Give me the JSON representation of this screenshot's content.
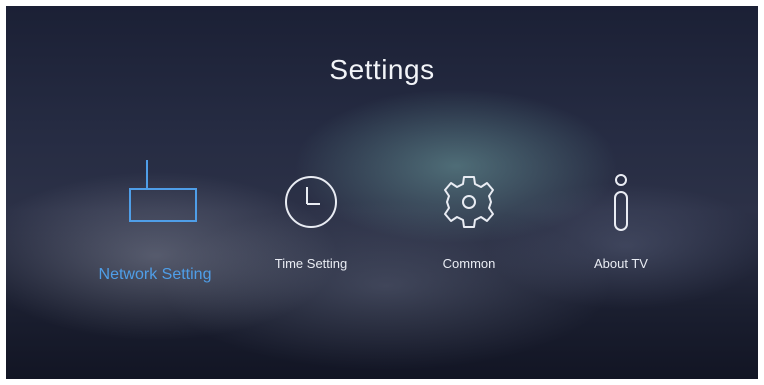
{
  "header": {
    "title": "Settings"
  },
  "menu": {
    "items": [
      {
        "label": "Network Setting",
        "icon": "router-icon",
        "selected": true
      },
      {
        "label": "Time Setting",
        "icon": "clock-icon",
        "selected": false
      },
      {
        "label": "Common",
        "icon": "gear-icon",
        "selected": false
      },
      {
        "label": "About TV",
        "icon": "info-icon",
        "selected": false
      }
    ]
  },
  "colors": {
    "accent": "#4f9ee8",
    "text": "#e9ecf3",
    "background": "#1f2438"
  }
}
